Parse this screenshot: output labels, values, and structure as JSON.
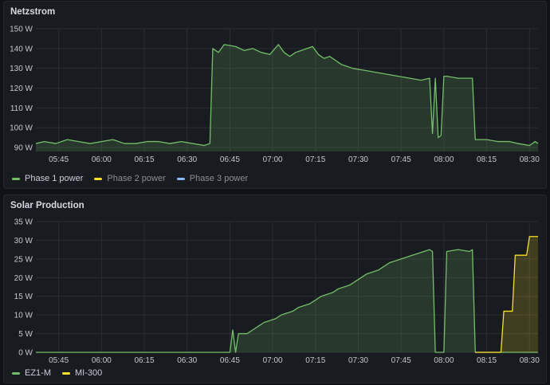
{
  "panels": [
    {
      "title": "Netzstrom",
      "legend": [
        {
          "name": "Phase 1 power",
          "color": "#73bf69",
          "dim": false
        },
        {
          "name": "Phase 2 power",
          "color": "#fade2a",
          "dim": true
        },
        {
          "name": "Phase 3 power",
          "color": "#8ab8ff",
          "dim": true
        }
      ]
    },
    {
      "title": "Solar Production",
      "legend": [
        {
          "name": "EZ1-M",
          "color": "#73bf69",
          "dim": false
        },
        {
          "name": "MI-300",
          "color": "#fade2a",
          "dim": false
        }
      ]
    }
  ],
  "chart_data": [
    {
      "type": "area",
      "title": "Netzstrom",
      "x_ticks": [
        "05:45",
        "06:00",
        "06:15",
        "06:30",
        "06:45",
        "07:00",
        "07:15",
        "07:30",
        "07:45",
        "08:00",
        "08:15",
        "08:30"
      ],
      "x_range": [
        "05:37",
        "08:33"
      ],
      "y_ticks": [
        "90 W",
        "100 W",
        "110 W",
        "120 W",
        "130 W",
        "140 W",
        "150 W"
      ],
      "ylim": [
        88,
        150
      ],
      "grid": true,
      "legend_position": "bottom-left",
      "series": [
        {
          "name": "Phase 1 power",
          "color": "#73bf69",
          "points": [
            [
              "05:37",
              92
            ],
            [
              "05:40",
              93
            ],
            [
              "05:44",
              92
            ],
            [
              "05:48",
              94
            ],
            [
              "05:52",
              93
            ],
            [
              "05:56",
              92
            ],
            [
              "06:00",
              93
            ],
            [
              "06:04",
              94
            ],
            [
              "06:08",
              92
            ],
            [
              "06:12",
              92
            ],
            [
              "06:16",
              93
            ],
            [
              "06:20",
              93
            ],
            [
              "06:24",
              92
            ],
            [
              "06:28",
              93
            ],
            [
              "06:32",
              92
            ],
            [
              "06:36",
              91
            ],
            [
              "06:38",
              92
            ],
            [
              "06:39",
              140
            ],
            [
              "06:41",
              138
            ],
            [
              "06:43",
              142
            ],
            [
              "06:47",
              141
            ],
            [
              "06:50",
              139
            ],
            [
              "06:53",
              140
            ],
            [
              "06:56",
              138
            ],
            [
              "06:59",
              137
            ],
            [
              "07:02",
              142
            ],
            [
              "07:04",
              138
            ],
            [
              "07:06",
              136
            ],
            [
              "07:08",
              138
            ],
            [
              "07:12",
              140
            ],
            [
              "07:14",
              141
            ],
            [
              "07:16",
              137
            ],
            [
              "07:18",
              135
            ],
            [
              "07:20",
              136
            ],
            [
              "07:24",
              132
            ],
            [
              "07:28",
              130
            ],
            [
              "07:32",
              129
            ],
            [
              "07:36",
              128
            ],
            [
              "07:40",
              127
            ],
            [
              "07:44",
              126
            ],
            [
              "07:48",
              125
            ],
            [
              "07:52",
              124
            ],
            [
              "07:55",
              125
            ],
            [
              "07:56",
              97
            ],
            [
              "07:57",
              125
            ],
            [
              "07:58",
              95
            ],
            [
              "07:59",
              96
            ],
            [
              "08:00",
              126
            ],
            [
              "08:01",
              126
            ],
            [
              "08:05",
              125
            ],
            [
              "08:10",
              125
            ],
            [
              "08:11",
              94
            ],
            [
              "08:15",
              94
            ],
            [
              "08:19",
              93
            ],
            [
              "08:23",
              93
            ],
            [
              "08:26",
              92
            ],
            [
              "08:30",
              91
            ],
            [
              "08:32",
              93
            ],
            [
              "08:33",
              92
            ]
          ]
        }
      ]
    },
    {
      "type": "area",
      "title": "Solar Production",
      "x_ticks": [
        "05:45",
        "06:00",
        "06:15",
        "06:30",
        "06:45",
        "07:00",
        "07:15",
        "07:30",
        "07:45",
        "08:00",
        "08:15",
        "08:30"
      ],
      "x_range": [
        "05:37",
        "08:33"
      ],
      "y_ticks": [
        "0 W",
        "5 W",
        "10 W",
        "15 W",
        "20 W",
        "25 W",
        "30 W",
        "35 W"
      ],
      "ylim": [
        0,
        35
      ],
      "grid": true,
      "legend_position": "bottom-left",
      "series": [
        {
          "name": "EZ1-M",
          "color": "#73bf69",
          "points": [
            [
              "05:37",
              0
            ],
            [
              "06:45",
              0
            ],
            [
              "06:46",
              6
            ],
            [
              "06:47",
              0
            ],
            [
              "06:48",
              5
            ],
            [
              "06:51",
              5
            ],
            [
              "06:53",
              6
            ],
            [
              "06:55",
              7
            ],
            [
              "06:57",
              8
            ],
            [
              "06:59",
              8.5
            ],
            [
              "07:01",
              9
            ],
            [
              "07:03",
              10
            ],
            [
              "07:05",
              10.5
            ],
            [
              "07:07",
              11
            ],
            [
              "07:09",
              12
            ],
            [
              "07:11",
              12.5
            ],
            [
              "07:13",
              13
            ],
            [
              "07:15",
              14
            ],
            [
              "07:17",
              15
            ],
            [
              "07:19",
              15.5
            ],
            [
              "07:21",
              16
            ],
            [
              "07:23",
              17
            ],
            [
              "07:25",
              17.5
            ],
            [
              "07:27",
              18
            ],
            [
              "07:29",
              19
            ],
            [
              "07:31",
              20
            ],
            [
              "07:33",
              21
            ],
            [
              "07:35",
              21.5
            ],
            [
              "07:37",
              22
            ],
            [
              "07:39",
              23
            ],
            [
              "07:41",
              24
            ],
            [
              "07:43",
              24.5
            ],
            [
              "07:45",
              25
            ],
            [
              "07:47",
              25.5
            ],
            [
              "07:49",
              26
            ],
            [
              "07:51",
              26.5
            ],
            [
              "07:53",
              27
            ],
            [
              "07:55",
              27.5
            ],
            [
              "07:56",
              27
            ],
            [
              "07:57",
              0
            ],
            [
              "08:00",
              0
            ],
            [
              "08:01",
              27
            ],
            [
              "08:05",
              27.5
            ],
            [
              "08:09",
              27
            ],
            [
              "08:10",
              27.5
            ],
            [
              "08:11",
              0
            ],
            [
              "08:33",
              0
            ]
          ]
        },
        {
          "name": "MI-300",
          "color": "#fade2a",
          "points": [
            [
              "08:11",
              0
            ],
            [
              "08:20",
              0
            ],
            [
              "08:21",
              11
            ],
            [
              "08:24",
              11
            ],
            [
              "08:25",
              26
            ],
            [
              "08:29",
              26
            ],
            [
              "08:30",
              31
            ],
            [
              "08:33",
              31
            ]
          ]
        }
      ]
    }
  ]
}
